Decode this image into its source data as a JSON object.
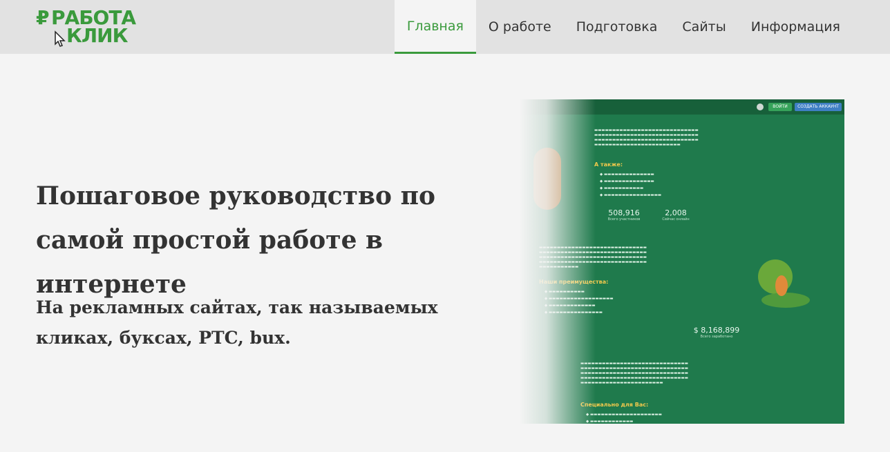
{
  "logo": {
    "line1": "РАБОТА",
    "line2": "КЛИК",
    "ruble": "₽"
  },
  "nav": {
    "items": [
      {
        "label": "Главная",
        "active": true
      },
      {
        "label": "О работе",
        "active": false
      },
      {
        "label": "Подготовка",
        "active": false
      },
      {
        "label": "Сайты",
        "active": false
      },
      {
        "label": "Информация",
        "active": false
      }
    ]
  },
  "hero": {
    "title": "Пошаговое руководство по самой простой работе в интернете",
    "subtitle": "На рекламных сайтах, так называемых кликах, буксах, PTC, bux."
  },
  "screenshot": {
    "login": "ВОЙТИ",
    "create": "СОЗДАТЬ АККАУНТ",
    "also_heading": "А также:",
    "stat_members_value": "508,916",
    "stat_members_label": "Всего участников",
    "stat_online_value": "2,008",
    "stat_online_label": "Сейчас онлайн",
    "advantages_heading": "Наши преимущества:",
    "stat_earned_value": "$ 8,168,899",
    "stat_earned_label": "Всего заработано",
    "special_heading": "Специально для Вас:"
  },
  "colors": {
    "accent": "#3a9a3c",
    "site_bg": "#1f7a4c",
    "text": "#333333"
  }
}
